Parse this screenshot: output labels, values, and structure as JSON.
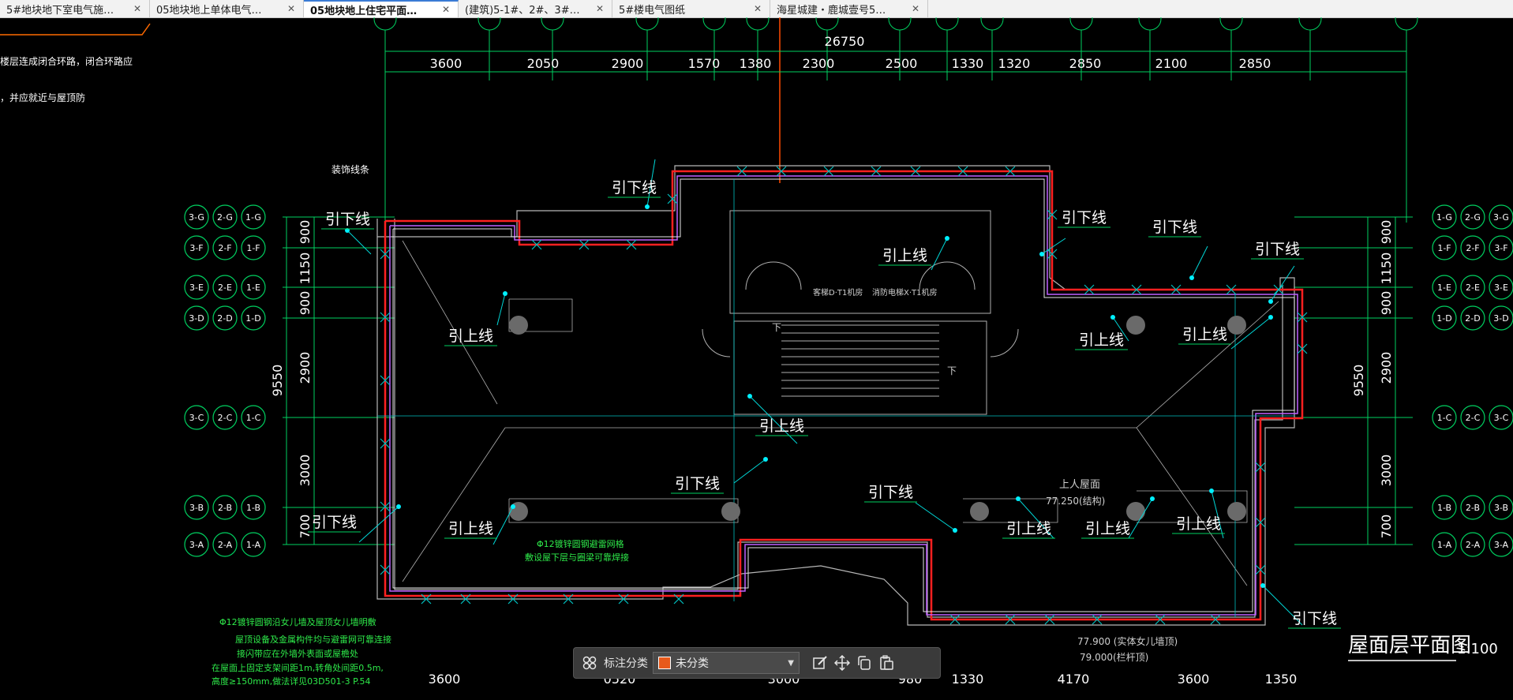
{
  "tabs": [
    {
      "label": "5#地块地下室电气施…",
      "active": false
    },
    {
      "label": "05地块地上单体电气…",
      "active": false
    },
    {
      "label": "05地块地上住宅平面…",
      "active": true
    },
    {
      "label": "(建筑)5-1#、2#、3#…",
      "active": false
    },
    {
      "label": "5#楼电气图纸",
      "active": false
    },
    {
      "label": "海星城建・鹿城壹号5…",
      "active": false
    }
  ],
  "close_glyph": "✕",
  "drawing": {
    "title": "屋面层平面图",
    "scale": "1:100",
    "overall_dim": "26750",
    "top_dims": [
      "3600",
      "2050",
      "2900",
      "1570",
      "1380",
      "2300",
      "2500",
      "1330",
      "1320",
      "2850",
      "2100",
      "2850"
    ],
    "bottom_dims": [
      "3600",
      "0520",
      "3000",
      "980",
      "1330",
      "4170",
      "3600",
      "1350"
    ],
    "left_dims": [
      "900",
      "1150",
      "900",
      "2900",
      "3000",
      "700"
    ],
    "right_dims": [
      "900",
      "1150",
      "900",
      "2900",
      "3000",
      "700"
    ],
    "left_total": "9550",
    "right_total": "9550",
    "left_axes": [
      {
        "labels": [
          "3-G",
          "2-G",
          "1-G"
        ]
      },
      {
        "labels": [
          "3-F",
          "2-F",
          "1-F"
        ]
      },
      {
        "labels": [
          "3-E",
          "2-E",
          "1-E"
        ]
      },
      {
        "labels": [
          "3-D",
          "2-D",
          "1-D"
        ]
      },
      {
        "labels": [
          "3-C",
          "2-C",
          "1-C"
        ]
      },
      {
        "labels": [
          "3-B",
          "2-B",
          "1-B"
        ]
      },
      {
        "labels": [
          "3-A",
          "2-A",
          "1-A"
        ]
      }
    ],
    "right_axes": [
      {
        "labels": [
          "1-G",
          "2-G",
          "3-G"
        ]
      },
      {
        "labels": [
          "1-F",
          "2-F",
          "3-F"
        ]
      },
      {
        "labels": [
          "1-E",
          "2-E",
          "3-E"
        ]
      },
      {
        "labels": [
          "1-D",
          "2-D",
          "3-D"
        ]
      },
      {
        "labels": [
          "1-C",
          "2-C",
          "3-C"
        ]
      },
      {
        "labels": [
          "1-B",
          "2-B",
          "3-B"
        ]
      },
      {
        "labels": [
          "1-A",
          "2-A",
          "3-A"
        ]
      }
    ],
    "callouts": [
      {
        "text": "引下线"
      },
      {
        "text": "引下线"
      },
      {
        "text": "引上线"
      },
      {
        "text": "引下线"
      },
      {
        "text": "引下线"
      },
      {
        "text": "引下线"
      },
      {
        "text": "引上线"
      },
      {
        "text": "引上线"
      },
      {
        "text": "引上线"
      },
      {
        "text": "引上线"
      },
      {
        "text": "引下线"
      },
      {
        "text": "引上线"
      },
      {
        "text": "引下线"
      },
      {
        "text": "引上线"
      },
      {
        "text": "引上线"
      },
      {
        "text": "引上线"
      },
      {
        "text": "引下线"
      },
      {
        "text": "引下线"
      }
    ],
    "notes": {
      "top_left_1": "楼层连成闭合环路，闭合环路应",
      "top_left_2": "，并应就近与屋顶防",
      "decor_line": "装饰线条",
      "roof_label": "上人屋面",
      "roof_elev": "77.250(结构)",
      "elev_1": "77.900 (实体女儿墙顶)",
      "elev_2": "79.000(栏杆顶)",
      "mesh_1": "Φ12镀锌圆钢避雷网格",
      "mesh_2": "敷设屋下层与圈梁可靠焊接",
      "bottom_1": "Φ12镀锌圆钢沿女儿墙及屋顶女儿墙明敷",
      "bottom_2": "屋顶设备及金属构件均与避雷网可靠连接",
      "bottom_3": "接闪带应在外墙外表面或屋檐处",
      "bottom_4": "在屋面上固定支架间距1m,转角处间距0.5m,",
      "bottom_5": "高度≥150mm,做法详见03D501-3 P.54",
      "room_1": "客梯D·T1机房",
      "room_2": "消防电梯X·T1机房",
      "down_1": "下",
      "down_2": "下"
    }
  },
  "toolbar": {
    "label": "标注分类",
    "select_value": "未分类",
    "swatch_color": "#e85a1b",
    "icons": [
      "grid-icon",
      "edit-icon",
      "move-icon",
      "copy-icon",
      "paste-icon"
    ]
  }
}
